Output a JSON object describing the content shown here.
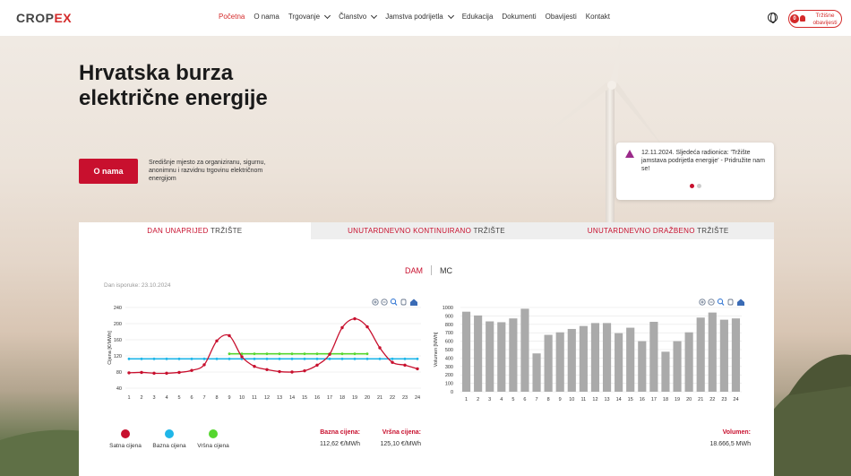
{
  "header": {
    "logo": {
      "text": "CROP",
      "mark": "EX"
    },
    "nav": [
      {
        "label": "Početna",
        "active": true,
        "dropdown": false
      },
      {
        "label": "O nama",
        "active": false,
        "dropdown": false
      },
      {
        "label": "Trgovanje",
        "active": false,
        "dropdown": true
      },
      {
        "label": "Članstvo",
        "active": false,
        "dropdown": true
      },
      {
        "label": "Jamstva podrijetla",
        "active": false,
        "dropdown": true
      },
      {
        "label": "Edukacija",
        "active": false,
        "dropdown": false
      },
      {
        "label": "Dokumenti",
        "active": false,
        "dropdown": false
      },
      {
        "label": "Obavijesti",
        "active": false,
        "dropdown": false
      },
      {
        "label": "Kontakt",
        "active": false,
        "dropdown": false
      }
    ],
    "notifications": {
      "count": "0",
      "label": "Tržišne obavijesti"
    },
    "icons": {
      "language": "globe-icon",
      "bell": "bell-icon"
    }
  },
  "hero": {
    "title": "Hrvatska burza električne energije",
    "button": "O nama",
    "description": "Središnje mjesto za organiziranu, sigurnu, anonimnu i razvidnu trgovinu električnom energijom"
  },
  "news": {
    "icon": "warning-triangle-icon",
    "text": "12.11.2024. Sljedeća radionica: 'Tržište jamstava podrijetla energije' - Pridružite nam se!",
    "active_dot": 0,
    "dot_count": 2
  },
  "market": {
    "tabs": [
      {
        "highlight": "DAN UNAPRIJED",
        "rest": " TRŽIŠTE",
        "active": true
      },
      {
        "highlight": "UNUTARDNEVNO KONTINUIRANO",
        "rest": " TRŽIŠTE",
        "active": false
      },
      {
        "highlight": "UNUTARDNEVNO DRAŽBENO",
        "rest": " TRŽIŠTE",
        "active": false
      }
    ],
    "toggle": {
      "option_a": "DAM",
      "option_b": "MC",
      "selected": "DAM"
    },
    "delivery_date": "Dan isporuke: 23.10.2024",
    "legend": [
      {
        "label": "Satna cijena",
        "color": "#c8102e"
      },
      {
        "label": "Bazna cijena",
        "color": "#1fb6e8"
      },
      {
        "label": "Vršna cijena",
        "color": "#55d62e"
      }
    ],
    "stats": {
      "base_label": "Bazna cijena:",
      "base_value": "112,62 €/MWh",
      "peak_label": "Vršna cijena:",
      "peak_value": "125,10 €/MWh",
      "volume_label": "Volumen:",
      "volume_value": "18.666,5 MWh"
    },
    "chart_tools": [
      "zoom-in-icon",
      "zoom-out-icon",
      "magnify-icon",
      "pan-hand-icon",
      "home-icon"
    ]
  },
  "chart_data": [
    {
      "type": "line",
      "title": "",
      "xlabel": "",
      "ylabel": "Cijena [€/MWh]",
      "x": [
        1,
        2,
        3,
        4,
        5,
        6,
        7,
        8,
        9,
        10,
        11,
        12,
        13,
        14,
        15,
        16,
        17,
        18,
        19,
        20,
        21,
        22,
        23,
        24
      ],
      "ylim": [
        40,
        240
      ],
      "yticks": [
        40,
        80,
        120,
        160,
        200,
        240
      ],
      "series": [
        {
          "name": "Satna cijena",
          "color": "#c8102e",
          "values": [
            78,
            79,
            77,
            77,
            79,
            84,
            98,
            157,
            170,
            118,
            94,
            86,
            81,
            80,
            83,
            97,
            124,
            190,
            212,
            192,
            140,
            104,
            97,
            88
          ]
        },
        {
          "name": "Bazna cijena",
          "color": "#1fb6e8",
          "values": [
            112.62,
            112.62,
            112.62,
            112.62,
            112.62,
            112.62,
            112.62,
            112.62,
            112.62,
            112.62,
            112.62,
            112.62,
            112.62,
            112.62,
            112.62,
            112.62,
            112.62,
            112.62,
            112.62,
            112.62,
            112.62,
            112.62,
            112.62,
            112.62
          ]
        },
        {
          "name": "Vršna cijena",
          "color": "#55d62e",
          "x": [
            9,
            10,
            11,
            12,
            13,
            14,
            15,
            16,
            17,
            18,
            19,
            20
          ],
          "values": [
            125.1,
            125.1,
            125.1,
            125.1,
            125.1,
            125.1,
            125.1,
            125.1,
            125.1,
            125.1,
            125.1,
            125.1
          ]
        }
      ],
      "grid": true
    },
    {
      "type": "bar",
      "title": "",
      "xlabel": "",
      "ylabel": "Volumen [MWh]",
      "categories": [
        1,
        2,
        3,
        4,
        5,
        6,
        7,
        8,
        9,
        10,
        11,
        12,
        13,
        14,
        15,
        16,
        17,
        18,
        19,
        20,
        21,
        22,
        23,
        24
      ],
      "values": [
        950,
        905,
        835,
        825,
        870,
        985,
        455,
        675,
        705,
        745,
        780,
        815,
        815,
        695,
        760,
        600,
        830,
        475,
        600,
        705,
        880,
        940,
        855,
        870
      ],
      "ylim": [
        0,
        1000
      ],
      "yticks": [
        0,
        100,
        200,
        300,
        400,
        500,
        600,
        700,
        800,
        900,
        1000
      ],
      "color": "#aaaaaa",
      "grid": true
    }
  ]
}
